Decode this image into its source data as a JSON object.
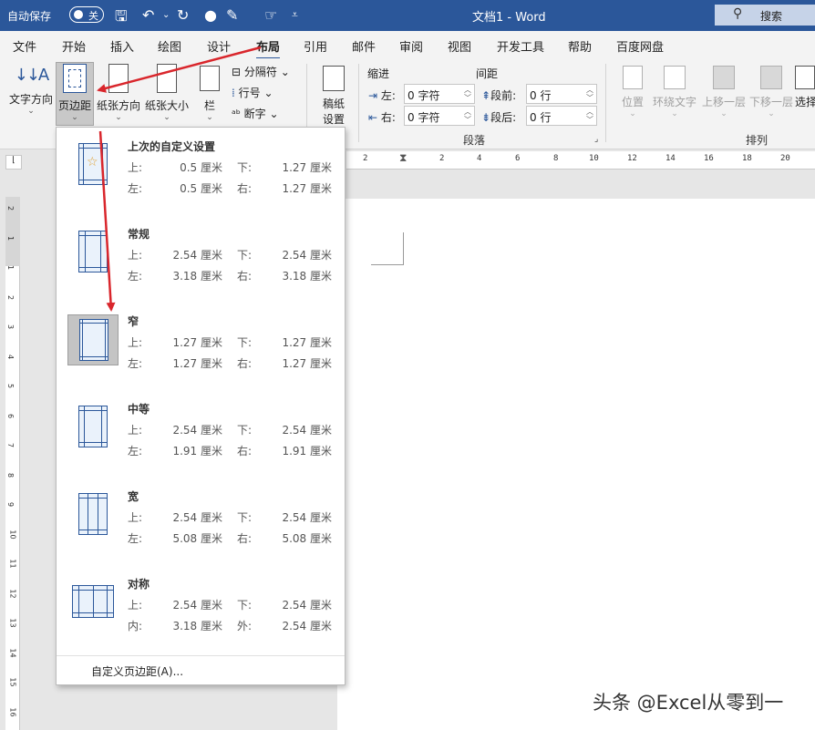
{
  "titlebar": {
    "autosave_label": "自动保存",
    "autosave_state": "关",
    "doc_title": "文档1  -  Word",
    "search_label": "搜索"
  },
  "tabs": [
    "文件",
    "开始",
    "插入",
    "绘图",
    "设计",
    "布局",
    "引用",
    "邮件",
    "审阅",
    "视图",
    "开发工具",
    "帮助",
    "百度网盘"
  ],
  "active_tab": "布局",
  "ribbon": {
    "text_direction": "文字方向",
    "margins": "页边距",
    "orientation": "纸张方向",
    "size": "纸张大小",
    "columns": "栏",
    "breaks": "分隔符",
    "line_numbers": "行号",
    "hyphenation": "断字",
    "draft_paper_1": "稿纸",
    "draft_paper_2": "设置",
    "indent_header": "缩进",
    "spacing_header": "间距",
    "indent_left_label": "左:",
    "indent_left_value": "0 字符",
    "indent_right_label": "右:",
    "indent_right_value": "0 字符",
    "before_label": "段前:",
    "before_value": "0 行",
    "after_label": "段后:",
    "after_value": "0 行",
    "paragraph_group": "段落",
    "position": "位置",
    "wrap_text": "环绕文字",
    "bring_forward": "上移一层",
    "send_backward": "下移一层",
    "select": "选择",
    "arrange_group": "排列"
  },
  "ruler_numbers": [
    "2",
    "2",
    "4",
    "6",
    "8",
    "10",
    "12",
    "14",
    "16",
    "18",
    "20"
  ],
  "vruler_numbers": [
    "2",
    "1",
    "1",
    "2",
    "3",
    "4",
    "5",
    "6",
    "7",
    "8",
    "9",
    "10",
    "11",
    "12",
    "13",
    "14",
    "15",
    "16"
  ],
  "margins_menu": {
    "options": [
      {
        "title": "上次的自定义设置",
        "k1": "上:",
        "v1": "0.5 厘米",
        "k2": "下:",
        "v2": "1.27 厘米",
        "k3": "左:",
        "v3": "0.5 厘米",
        "k4": "右:",
        "v4": "1.27 厘米"
      },
      {
        "title": "常规",
        "k1": "上:",
        "v1": "2.54 厘米",
        "k2": "下:",
        "v2": "2.54 厘米",
        "k3": "左:",
        "v3": "3.18 厘米",
        "k4": "右:",
        "v4": "3.18 厘米"
      },
      {
        "title": "窄",
        "k1": "上:",
        "v1": "1.27 厘米",
        "k2": "下:",
        "v2": "1.27 厘米",
        "k3": "左:",
        "v3": "1.27 厘米",
        "k4": "右:",
        "v4": "1.27 厘米"
      },
      {
        "title": "中等",
        "k1": "上:",
        "v1": "2.54 厘米",
        "k2": "下:",
        "v2": "2.54 厘米",
        "k3": "左:",
        "v3": "1.91 厘米",
        "k4": "右:",
        "v4": "1.91 厘米"
      },
      {
        "title": "宽",
        "k1": "上:",
        "v1": "2.54 厘米",
        "k2": "下:",
        "v2": "2.54 厘米",
        "k3": "左:",
        "v3": "5.08 厘米",
        "k4": "右:",
        "v4": "5.08 厘米"
      },
      {
        "title": "对称",
        "k1": "上:",
        "v1": "2.54 厘米",
        "k2": "下:",
        "v2": "2.54 厘米",
        "k3": "内:",
        "v3": "3.18 厘米",
        "k4": "外:",
        "v4": "2.54 厘米"
      }
    ],
    "selected_index": 2,
    "custom_label": "自定义页边距(A)..."
  },
  "watermark": "头条 @Excel从零到一",
  "colors": {
    "accent": "#2b579a",
    "arrow": "#d9262c"
  }
}
